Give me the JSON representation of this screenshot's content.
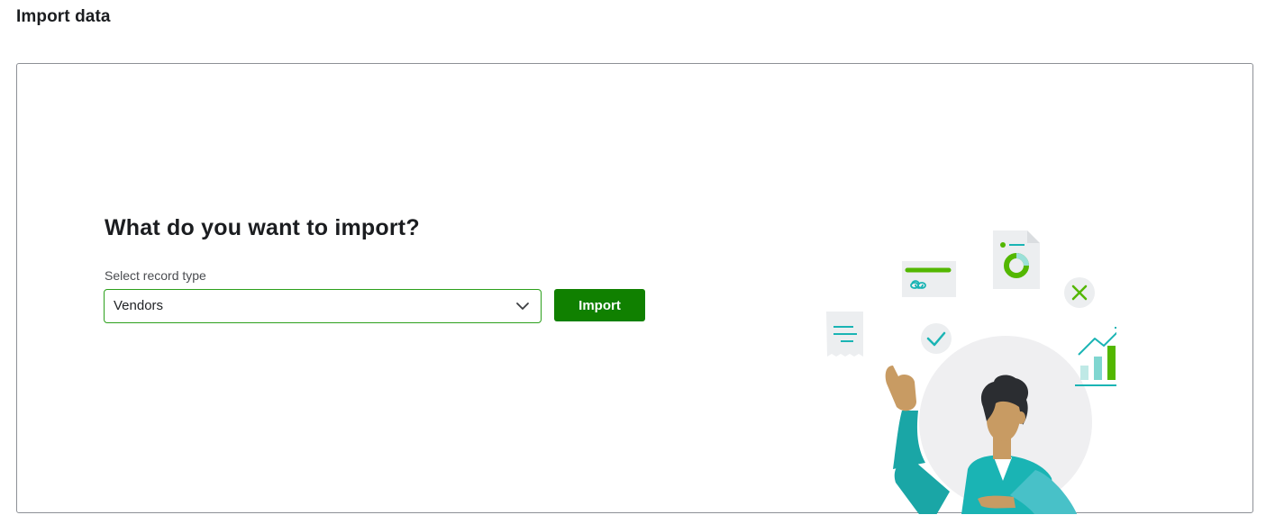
{
  "page": {
    "title": "Import data"
  },
  "import_form": {
    "heading": "What do you want to import?",
    "select_label": "Select record type",
    "selected_value": "Vendors",
    "import_button_label": "Import"
  },
  "colors": {
    "accent_green": "#108000",
    "select_border": "#2ca01c",
    "card_border": "#8d9096",
    "illustration_teal": "#1ab4b4",
    "illustration_green": "#53b700"
  },
  "icons": {
    "select_chevron": "chevron-down-icon",
    "illustration": "person-presenting-documents-illustration"
  }
}
